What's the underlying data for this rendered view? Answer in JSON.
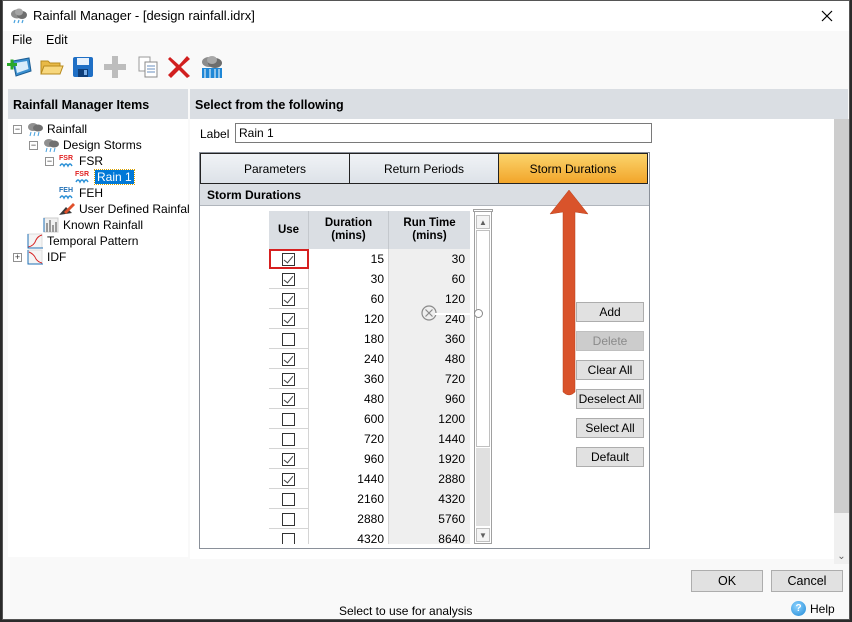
{
  "window": {
    "title": "Rainfall Manager - [design rainfall.idrx]",
    "close_icon": "close-icon"
  },
  "menu": {
    "file": "File",
    "edit": "Edit"
  },
  "toolbar": {
    "items": [
      {
        "name": "new-icon",
        "tooltip": "New"
      },
      {
        "name": "open-folder-icon",
        "tooltip": "Open"
      },
      {
        "name": "save-icon",
        "tooltip": "Save"
      },
      {
        "name": "add-icon",
        "tooltip": "Add"
      },
      {
        "name": "copy-icon",
        "tooltip": "Copy"
      },
      {
        "name": "delete-icon",
        "tooltip": "Delete"
      },
      {
        "name": "rainfall-icon",
        "tooltip": "Rainfall"
      }
    ]
  },
  "left_panel": {
    "header": "Rainfall Manager Items",
    "tree": [
      {
        "label": "Rainfall",
        "expander": "minus",
        "icon": "cloud-rain-icon"
      },
      {
        "label": "Design Storms",
        "expander": "minus",
        "icon": "cloud-rain-icon"
      },
      {
        "label": "FSR",
        "expander": "minus",
        "icon": "fsr-icon"
      },
      {
        "label": "Rain 1",
        "icon": "fsr-icon",
        "selected": true
      },
      {
        "label": "FEH",
        "icon": "feh-icon"
      },
      {
        "label": "User Defined Rainfall",
        "icon": "pencil-icon"
      },
      {
        "label": "Known Rainfall",
        "icon": "bar-chart-icon"
      },
      {
        "label": "Temporal Pattern",
        "icon": "temporal-chart-icon"
      },
      {
        "label": "IDF",
        "expander": "plus",
        "icon": "idf-chart-icon"
      }
    ]
  },
  "right_panel": {
    "header": "Select from the following",
    "label_caption": "Label",
    "label_value": "Rain 1",
    "tabs": [
      {
        "label": "Parameters",
        "active": false
      },
      {
        "label": "Return Periods",
        "active": false
      },
      {
        "label": "Storm Durations",
        "active": true
      }
    ],
    "section_title": "Storm Durations",
    "grid": {
      "columns": [
        "Use",
        "Duration\n(mins)",
        "Run Time\n(mins)"
      ],
      "col_use": "Use",
      "col_duration_1": "Duration",
      "col_duration_2": "(mins)",
      "col_runtime_1": "Run Time",
      "col_runtime_2": "(mins)",
      "rows": [
        {
          "use": true,
          "duration": "15",
          "run_time": "30"
        },
        {
          "use": true,
          "duration": "30",
          "run_time": "60"
        },
        {
          "use": true,
          "duration": "60",
          "run_time": "120"
        },
        {
          "use": true,
          "duration": "120",
          "run_time": "240"
        },
        {
          "use": false,
          "duration": "180",
          "run_time": "360"
        },
        {
          "use": true,
          "duration": "240",
          "run_time": "480"
        },
        {
          "use": true,
          "duration": "360",
          "run_time": "720"
        },
        {
          "use": true,
          "duration": "480",
          "run_time": "960"
        },
        {
          "use": false,
          "duration": "600",
          "run_time": "1200"
        },
        {
          "use": false,
          "duration": "720",
          "run_time": "1440"
        },
        {
          "use": true,
          "duration": "960",
          "run_time": "1920"
        },
        {
          "use": true,
          "duration": "1440",
          "run_time": "2880"
        },
        {
          "use": false,
          "duration": "2160",
          "run_time": "4320"
        },
        {
          "use": false,
          "duration": "2880",
          "run_time": "5760"
        },
        {
          "use": false,
          "duration": "4320",
          "run_time": "8640"
        }
      ]
    },
    "buttons": {
      "add": "Add",
      "delete": "Delete",
      "clear_all": "Clear All",
      "deselect_all": "Deselect All",
      "select_all": "Select All",
      "default": "Default"
    }
  },
  "footer": {
    "ok": "OK",
    "cancel": "Cancel",
    "status": "Select to use for analysis",
    "help": "Help"
  },
  "colors": {
    "active_tab_top": "#fbd46c",
    "active_tab_bottom": "#f2a52a",
    "header_bg": "#dadee3",
    "selection": "#0078d7",
    "annotation_arrow": "#d9532b",
    "focus_outline": "#d62020"
  }
}
